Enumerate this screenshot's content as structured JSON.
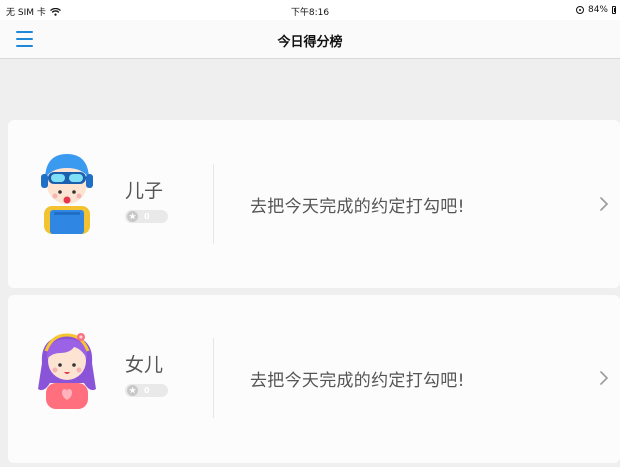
{
  "status_bar": {
    "carrier": "无 SIM 卡",
    "time": "下午8:16",
    "battery": "84%"
  },
  "header": {
    "title": "今日得分榜"
  },
  "members": [
    {
      "name": "儿子",
      "score": "0",
      "prompt": "去把今天完成的约定打勾吧!"
    },
    {
      "name": "女儿",
      "score": "0",
      "prompt": "去把今天完成的约定打勾吧!"
    }
  ],
  "colors": {
    "accent": "#1e88d8",
    "background": "#efefef",
    "card": "#fcfcfc"
  },
  "icons": {
    "menu": "hamburger-menu-icon",
    "wifi": "wifi-icon",
    "rotation_lock": "rotation-lock-icon",
    "battery": "battery-icon",
    "star": "star-icon",
    "chevron": "chevron-right-icon",
    "son_avatar": "boy-avatar",
    "daughter_avatar": "girl-avatar"
  }
}
